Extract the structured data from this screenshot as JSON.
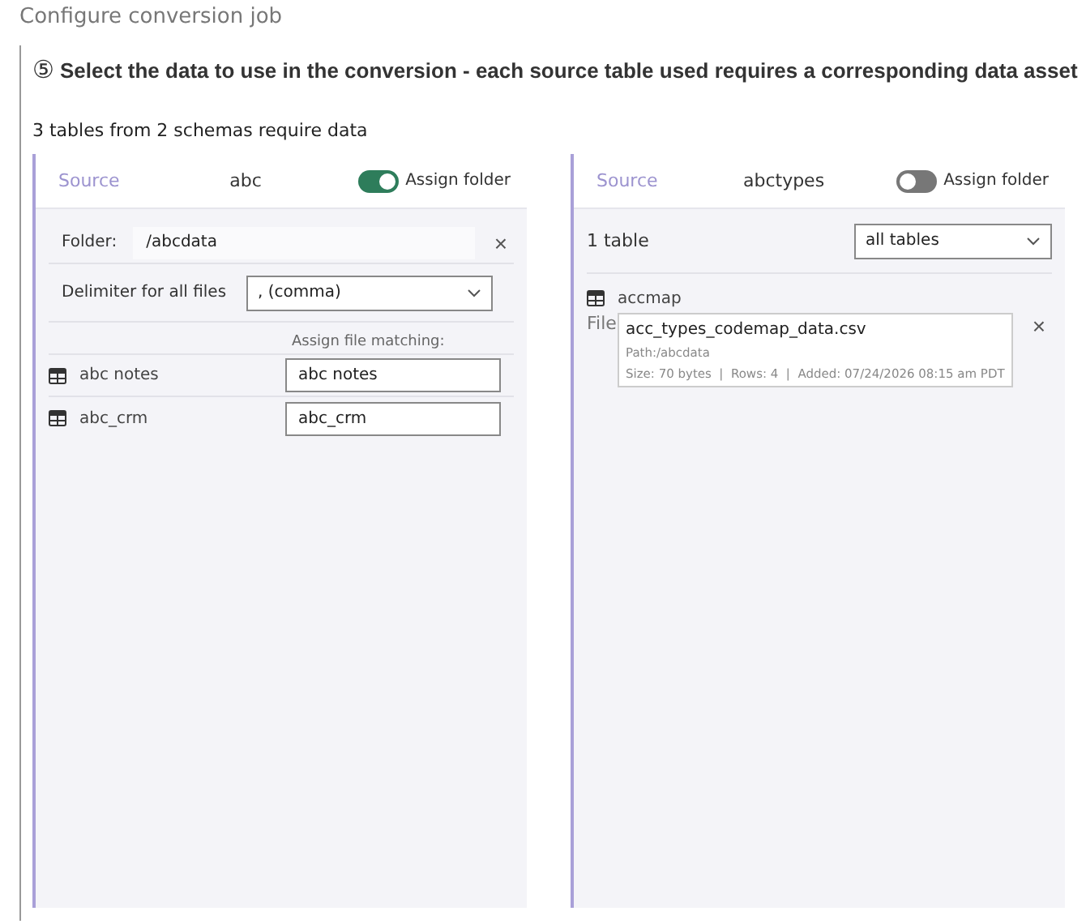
{
  "page_title": "Configure conversion job",
  "step": {
    "number": "⑤",
    "title": "Select the data to use in the conversion - each source table used requires a corresponding data asset"
  },
  "summary": "3 tables from 2 schemas require data",
  "panels": [
    {
      "kind": "folder",
      "source_label": "Source",
      "schema": "abc",
      "assign_folder": {
        "label": "Assign folder",
        "on": true
      },
      "folder": {
        "label": "Folder:",
        "value": "/abcdata",
        "clear": "×"
      },
      "delimiter": {
        "label": "Delimiter for all files",
        "value": ", (comma)"
      },
      "match_heading": "Assign file matching:",
      "tables": [
        {
          "name": "abc notes",
          "value": "abc notes"
        },
        {
          "name": "abc_crm",
          "value": "abc_crm"
        }
      ]
    },
    {
      "kind": "files",
      "source_label": "Source",
      "schema": "abctypes",
      "assign_folder": {
        "label": "Assign folder",
        "on": false
      },
      "count": "1 table",
      "filter": "all tables",
      "tables": [
        {
          "name": "accmap",
          "file_label": "File",
          "file": {
            "name": "acc_types_codemap_data.csv",
            "path": "Path:/abcdata",
            "meta": "Size: 70 bytes  |  Rows: 4  |  Added: 07/24/2026 08:15 am PDT"
          },
          "clear": "×"
        }
      ]
    }
  ]
}
